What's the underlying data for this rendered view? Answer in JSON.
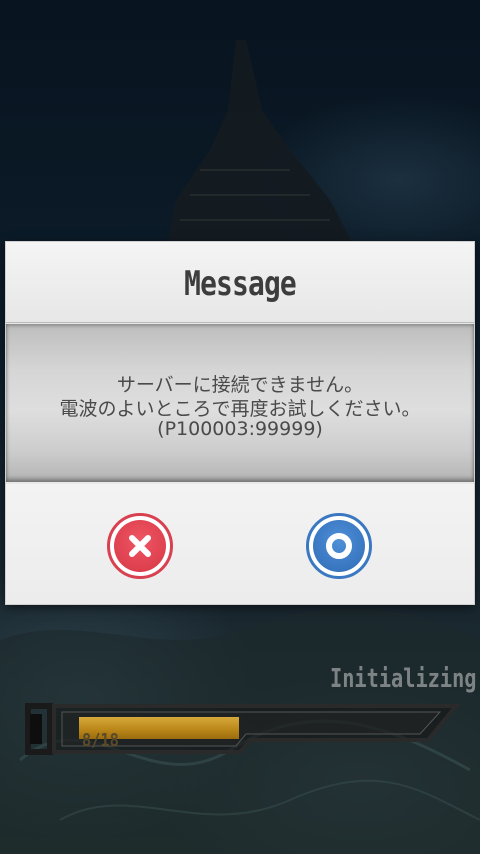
{
  "dialog": {
    "title": "Message",
    "message_lines": [
      "サーバーに接続できません。",
      "電波のよいところで再度お試しください。",
      "(P100003:99999)"
    ],
    "cancel_icon": "close-x-icon",
    "ok_icon": "circle-o-icon"
  },
  "loading": {
    "status": "Initializing",
    "count_label": "8/18",
    "progress_fraction": 0.444
  },
  "colors": {
    "cancel": "#d8414f",
    "ok": "#3a78c1",
    "progress": "#c7961f"
  }
}
